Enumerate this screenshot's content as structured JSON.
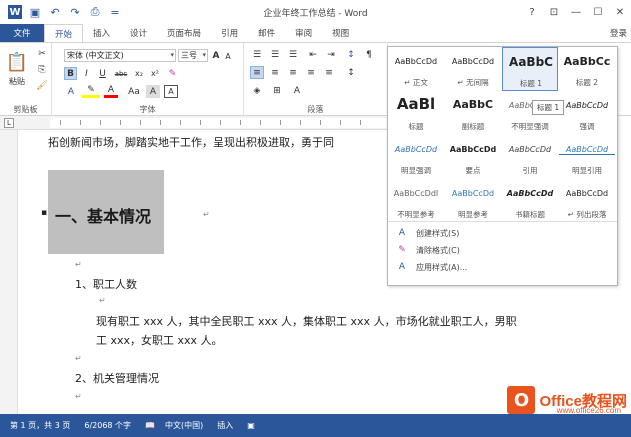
{
  "window": {
    "title": "企业年终工作总结 - Word",
    "help": "?",
    "controls": [
      "⊡",
      "—",
      "☐",
      "✕"
    ]
  },
  "tabs": [
    {
      "label": "文件"
    },
    {
      "label": "开始"
    },
    {
      "label": "插入"
    },
    {
      "label": "设计"
    },
    {
      "label": "页面布局"
    },
    {
      "label": "引用"
    },
    {
      "label": "邮件"
    },
    {
      "label": "审阅"
    },
    {
      "label": "视图"
    }
  ],
  "signin": "登录",
  "ribbon": {
    "clipboard_label": "剪贴板",
    "paste_label": "粘贴",
    "font_label": "字体",
    "paragraph_label": "段落",
    "font_name": "宋体 (中文正文)",
    "font_size": "三号",
    "font_btns": [
      "B",
      "I",
      "U",
      "abc",
      "x₂",
      "x²"
    ],
    "font_btns2": [
      "A",
      "A",
      "A",
      "Aa",
      "A"
    ]
  },
  "styles_gallery": {
    "rows": [
      [
        {
          "preview": "AaBbCcDd",
          "name": "↵ 正文"
        },
        {
          "preview": "AaBbCcDd",
          "name": "↵ 无间隔"
        },
        {
          "preview": "AaBbC",
          "name": "标题 1"
        },
        {
          "preview": "AaBbCc",
          "name": "标题 2"
        }
      ],
      [
        {
          "preview": "AaBl",
          "name": "标题"
        },
        {
          "preview": "AaBbC",
          "name": "副标题"
        },
        {
          "preview": "AaBbCcDd",
          "name": "不明显强调"
        },
        {
          "preview": "AaBbCcDd",
          "name": "强调"
        }
      ],
      [
        {
          "preview": "AaBbCcDd",
          "name": "明显强调"
        },
        {
          "preview": "AaBbCcDd",
          "name": "要点"
        },
        {
          "preview": "AaBbCcDd",
          "name": "引用"
        },
        {
          "preview": "AaBbCcDd",
          "name": "明显引用"
        }
      ],
      [
        {
          "preview": "AaBbCcDdI",
          "name": "不明显参考"
        },
        {
          "preview": "AaBbCcDd",
          "name": "明显参考"
        },
        {
          "preview": "AaBbCcDd",
          "name": "书籍标题"
        },
        {
          "preview": "AaBbCcDd",
          "name": "↵ 列出段落"
        }
      ]
    ],
    "tooltip": "标题 1",
    "commands": [
      {
        "icon": "create-style-icon",
        "label": "创建样式(S)"
      },
      {
        "icon": "clear-format-icon",
        "label": "清除格式(C)"
      },
      {
        "icon": "apply-styles-icon",
        "label": "应用样式(A)..."
      }
    ]
  },
  "document": {
    "line1": "拓创新闻市场，脚踏实地干工作，呈现出积极进取，勇于同",
    "heading": "一、基本情况",
    "item1": "1、职工人数",
    "para1": "现有职工 xxx 人，其中全民职工 xxx 人，集体职工 xxx 人，市场化就业职工人，男职",
    "para2": "工 xxx，女职工 xxx 人。",
    "item2": "2、机关管理情况",
    "mark": "↵"
  },
  "statusbar": {
    "page": "第 1 页，共 3 页",
    "words": "6/2068 个字",
    "lang": "中文(中国)",
    "mode": "插入"
  },
  "watermark": {
    "text": "Office教程网",
    "sub": "www.office26.com"
  },
  "colors": {
    "accent": "#2b579a",
    "watermark": "#e8531e"
  }
}
